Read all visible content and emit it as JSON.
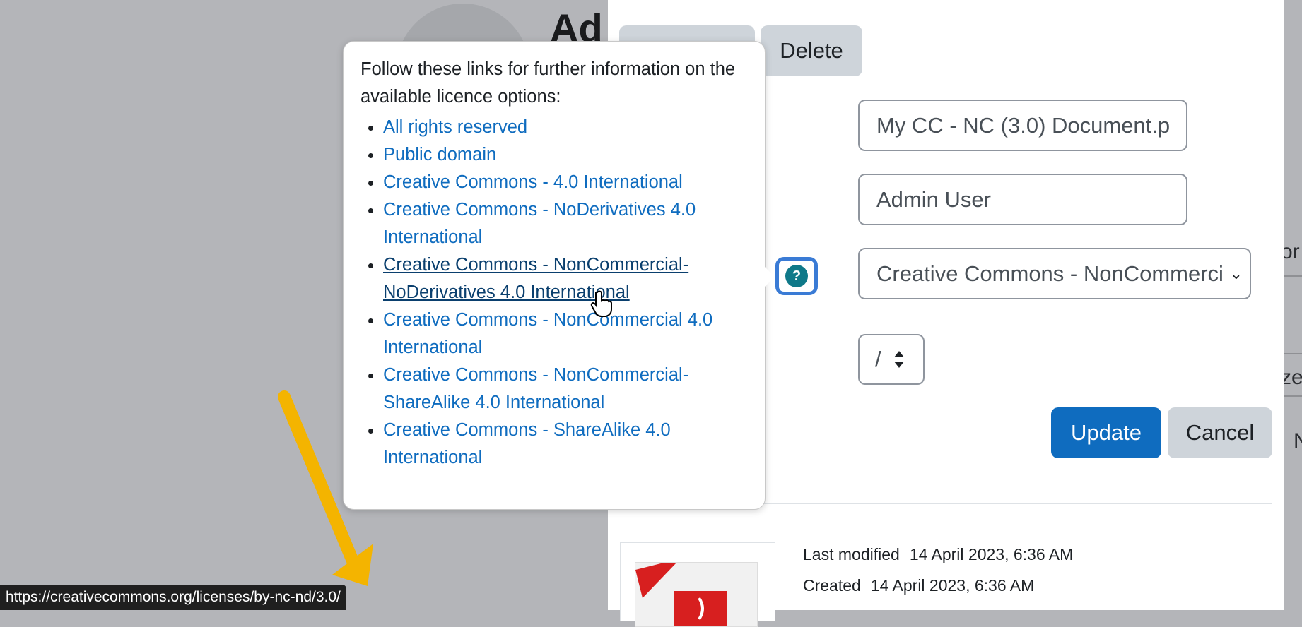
{
  "background": {
    "heading": "Ad",
    "edge_text_1": "or",
    "edge_text_2": "ze",
    "edge_text_3": "N"
  },
  "dialog": {
    "delete_label": "Delete",
    "filename_value": "My CC - NC (3.0) Document.p",
    "author_value": "Admin User",
    "license_selected": "Creative Commons - NonCommerci",
    "path_value": "/",
    "update_label": "Update",
    "cancel_label": "Cancel",
    "last_modified_label": "Last modified",
    "last_modified_value": "14 April 2023, 6:36 AM",
    "created_label": "Created",
    "created_value": "14 April 2023, 6:36 AM",
    "accent_color": "#0f6cbf"
  },
  "popover": {
    "intro": "Follow these links for further information on the available licence options:",
    "links": [
      "All rights reserved",
      "Public domain",
      "Creative Commons - 4.0 International",
      "Creative Commons - NoDerivatives 4.0 International",
      "Creative Commons - NonCommercial-NoDerivatives 4.0 International",
      "Creative Commons - NonCommercial 4.0 International",
      "Creative Commons - NonCommercial-ShareAlike 4.0 International",
      "Creative Commons - ShareAlike 4.0 International"
    ],
    "hovered_index": 4
  },
  "statusbar": {
    "url": "https://creativecommons.org/licenses/by-nc-nd/3.0/"
  },
  "icons": {
    "help": "question-circle-icon",
    "select_caret": "chevron-down-icon",
    "stepper": "up-down-caret-icon",
    "pointer": "hand-pointer-icon",
    "annotation": "arrow-icon"
  }
}
